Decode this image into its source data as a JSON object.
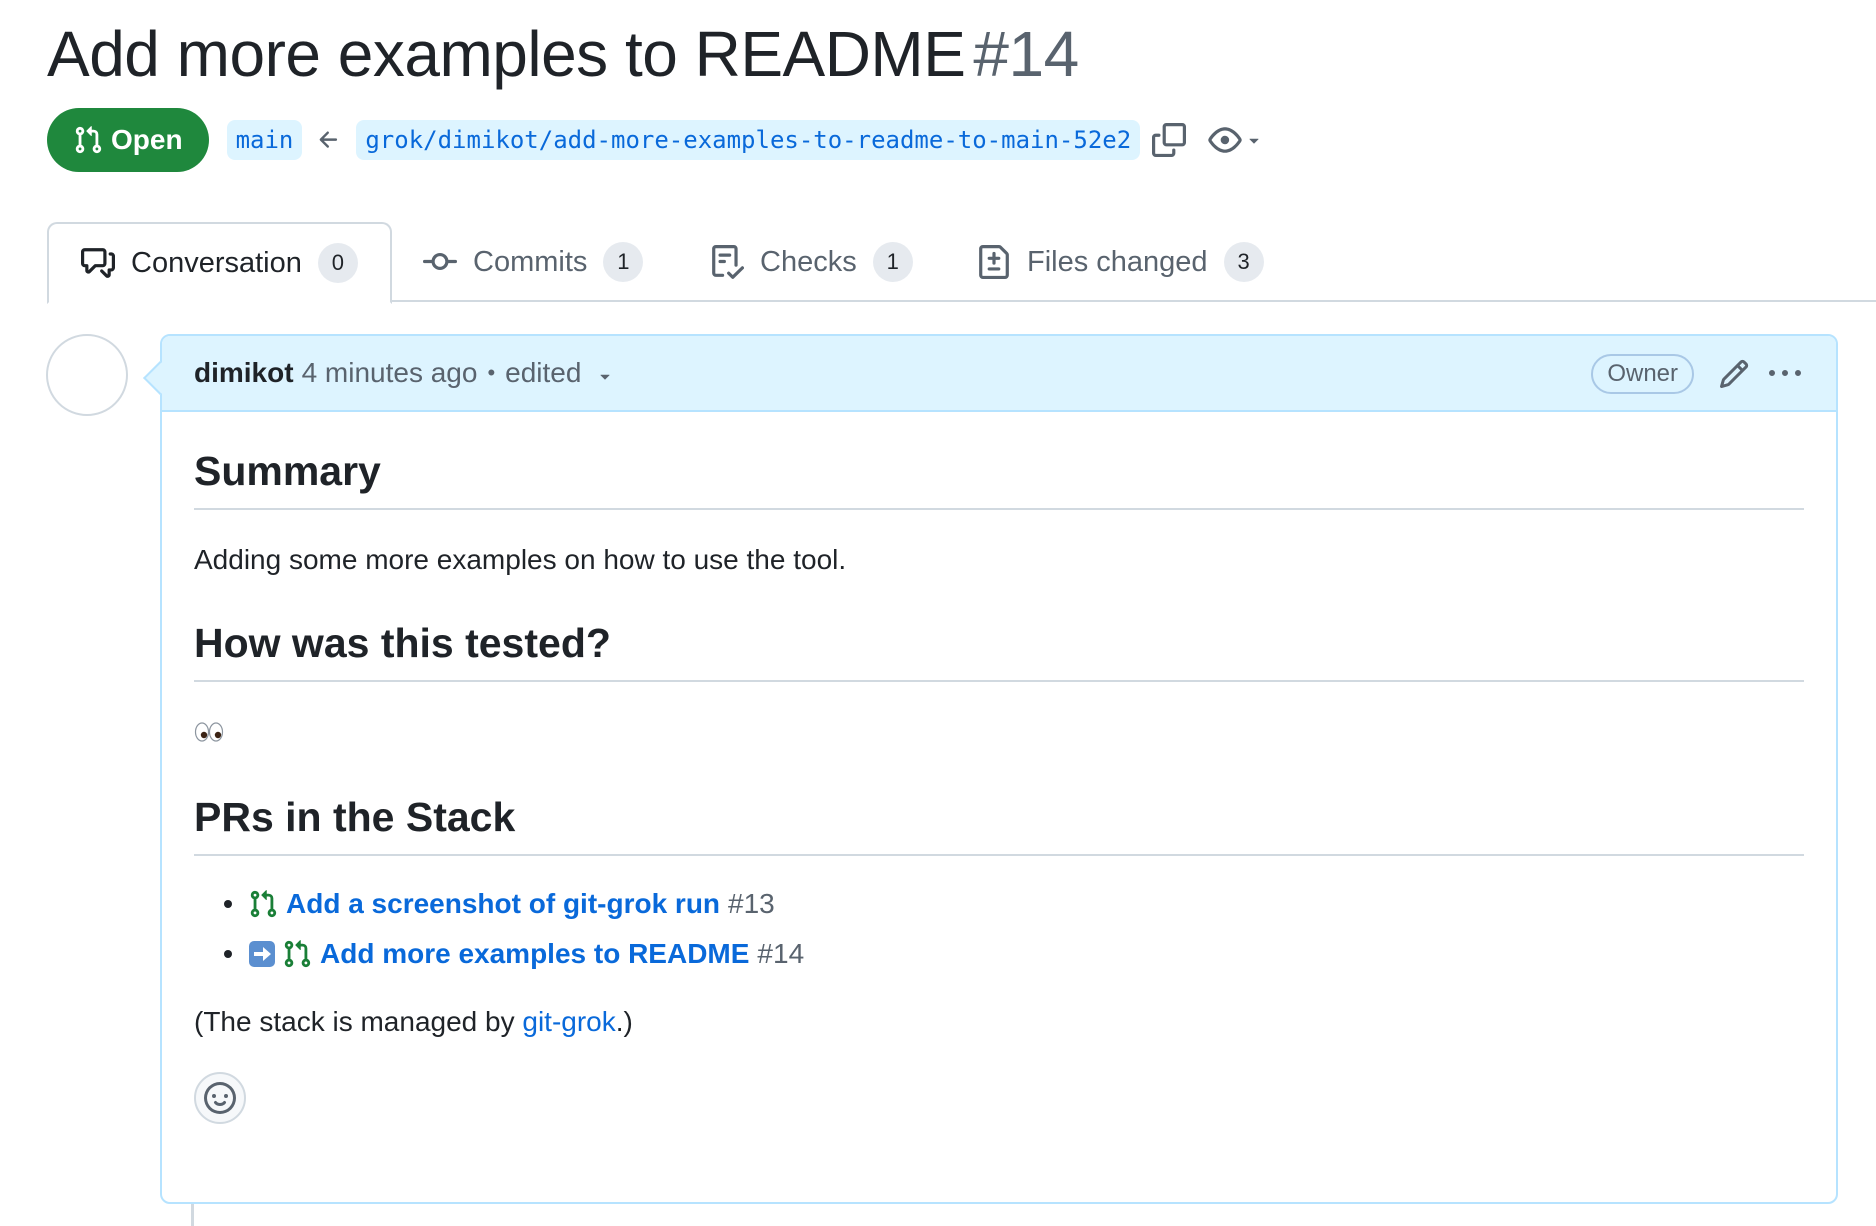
{
  "pr": {
    "title": "Add more examples to README",
    "number": "#14",
    "state": "Open",
    "base_branch": "main",
    "head_branch": "grok/dimikot/add-more-examples-to-readme-to-main-52e2"
  },
  "tabs": [
    {
      "label": "Conversation",
      "count": "0",
      "icon": "comment-discussion-icon"
    },
    {
      "label": "Commits",
      "count": "1",
      "icon": "git-commit-icon"
    },
    {
      "label": "Checks",
      "count": "1",
      "icon": "checklist-icon"
    },
    {
      "label": "Files changed",
      "count": "3",
      "icon": "file-diff-icon"
    }
  ],
  "comment": {
    "author": "dimikot",
    "time": "4 minutes ago",
    "separator": "•",
    "edited": "edited",
    "role": "Owner",
    "sections": {
      "summary_heading": "Summary",
      "summary_text": "Adding some more examples on how to use the tool.",
      "tested_heading": "How was this tested?",
      "tested_emoji": "eyes-emoji",
      "stack_heading": "PRs in the Stack"
    },
    "stack": [
      {
        "title": "Add a screenshot of git-grok run",
        "number": "#13",
        "current": false
      },
      {
        "title": "Add more examples to README",
        "number": "#14",
        "current": true
      }
    ],
    "managed_prefix": "(The stack is managed by ",
    "managed_link": "git-grok",
    "managed_suffix": ".)"
  },
  "colors": {
    "open_green": "#1f883d",
    "link_blue": "#0969da",
    "header_bg": "#ddf4ff",
    "border_blue": "#b6e3ff"
  }
}
